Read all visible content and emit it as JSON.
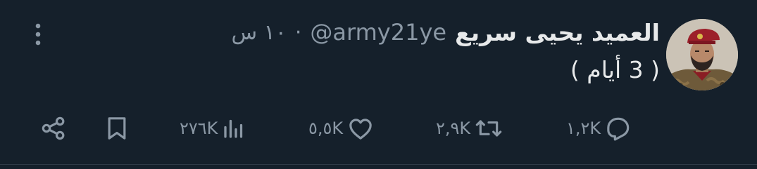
{
  "tweet": {
    "display_name": "العميد يحيى سريع",
    "handle": "@army21ye",
    "separator": "·",
    "time": "١٠ س",
    "text": "( 3 أيام )"
  },
  "actions": {
    "reply_count": "١,٢K",
    "retweet_count": "٢,٩K",
    "like_count": "٥,٥K",
    "views_count": "٢٧٦K"
  },
  "icons": {
    "more": "more-vertical-icon",
    "reply": "reply-icon",
    "retweet": "retweet-icon",
    "like": "heart-icon",
    "views": "views-chart-icon",
    "bookmark": "bookmark-icon",
    "share": "share-icon"
  },
  "colors": {
    "background": "#15202b",
    "primary_text": "#e7e9ea",
    "secondary_text": "#8b98a5"
  }
}
